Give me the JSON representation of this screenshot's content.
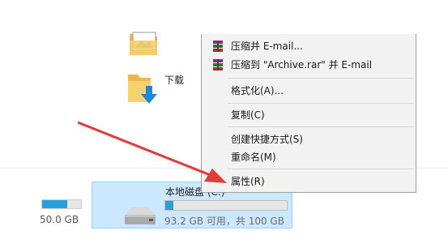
{
  "folders": {
    "downloads_label": "下载"
  },
  "drives": {
    "left_drive_size": "50.0 GB",
    "left_drive_used": 0.65,
    "selected_drive_name": "本地磁盘 (C:)",
    "selected_drive_free": "93.2 GB 可用，共 100 GB",
    "selected_drive_used": 0.068
  },
  "context_menu": {
    "items": [
      {
        "label": "压缩并 E-mail...",
        "icon": "winrar-icon"
      },
      {
        "label": "压缩到 \"Archive.rar\" 并 E-mail",
        "icon": "winrar-icon"
      },
      {
        "label": "格式化(A)..."
      },
      {
        "label": "复制(C)"
      },
      {
        "label": "创建快捷方式(S)"
      },
      {
        "label": "重命名(M)"
      },
      {
        "label": "属性(R)"
      }
    ]
  },
  "colors": {
    "accent": "#26a0da",
    "selection": "#cce8ff",
    "arrow": "#e23b3b"
  }
}
